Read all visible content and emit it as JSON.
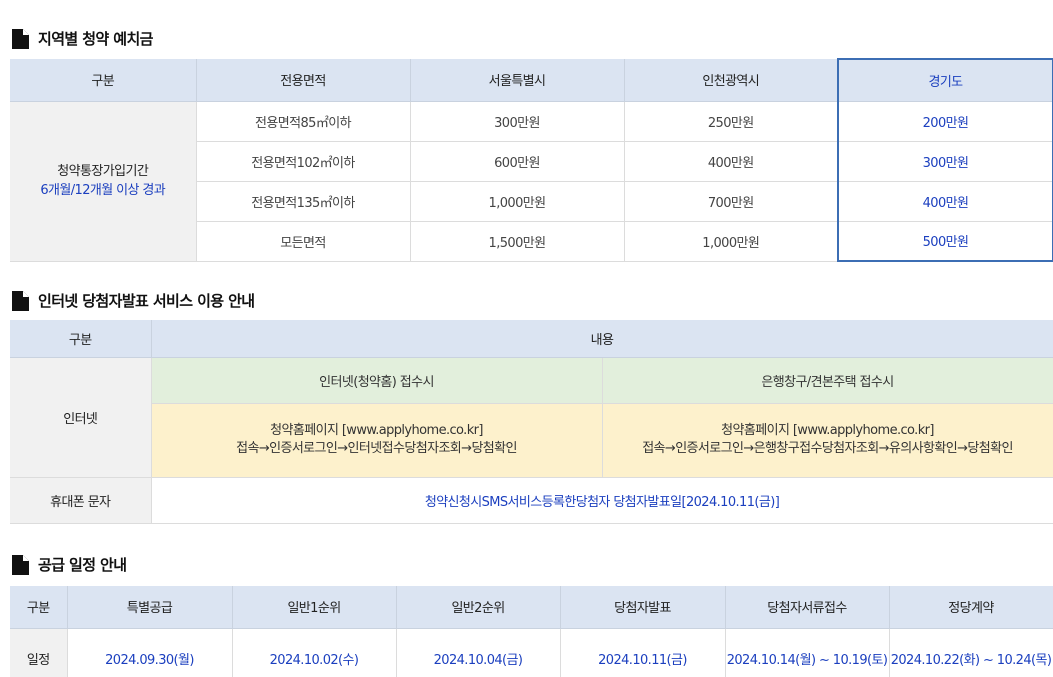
{
  "section1": {
    "title": "지역별 청약 예치금",
    "headers": [
      "구분",
      "전용면적",
      "서울특별시",
      "인천광역시",
      "경기도"
    ],
    "row_label_line1": "청약통장가입기간",
    "row_label_line2": "6개월/12개월 이상 경과",
    "rows": [
      {
        "area": "전용면적85㎡이하",
        "seoul": "300만원",
        "incheon": "250만원",
        "gyeonggi": "200만원"
      },
      {
        "area": "전용면적102㎡이하",
        "seoul": "600만원",
        "incheon": "400만원",
        "gyeonggi": "300만원"
      },
      {
        "area": "전용면적135㎡이하",
        "seoul": "1,000만원",
        "incheon": "700만원",
        "gyeonggi": "400만원"
      },
      {
        "area": "모든면적",
        "seoul": "1,500만원",
        "incheon": "1,000만원",
        "gyeonggi": "500만원"
      }
    ]
  },
  "section2": {
    "title": "인터넷 당첨자발표 서비스 이용 안내",
    "headers": [
      "구분",
      "내용"
    ],
    "internet_label": "인터넷",
    "col_a_title": "인터넷(청약홈) 접수시",
    "col_b_title": "은행창구/견본주택 접수시",
    "col_a_line1": "청약홈페이지 [www.applyhome.co.kr]",
    "col_a_line2": "접속→인증서로그인→인터넷접수당첨자조회→당첨확인",
    "col_b_line1": "청약홈페이지 [www.applyhome.co.kr]",
    "col_b_line2": "접속→인증서로그인→은행창구접수당첨자조회→유의사항확인→당첨확인",
    "sms_label": "휴대폰 문자",
    "sms_text": "청약신청시SMS서비스등록한당첨자 당첨자발표일[2024.10.11(금)]"
  },
  "section3": {
    "title": "공급 일정 안내",
    "headers": [
      "구분",
      "특별공급",
      "일반1순위",
      "일반2순위",
      "당첨자발표",
      "당첨자서류접수",
      "정당계약"
    ],
    "row_label": "일정",
    "values": [
      "2024.09.30(월)",
      "2024.10.02(수)",
      "2024.10.04(금)",
      "2024.10.11(금)",
      "2024.10.14(월) ~ 10.19(토)",
      "2024.10.22(화) ~ 10.24(목)"
    ]
  },
  "icons": {
    "section_icon": "document-icon"
  },
  "colors": {
    "header_bg": "#dbe4f2",
    "accent_blue": "#1b3fbf",
    "highlight_border": "#3c6eb4",
    "green_bg": "#e2efdc",
    "yellow_bg": "#fdf1cc"
  }
}
